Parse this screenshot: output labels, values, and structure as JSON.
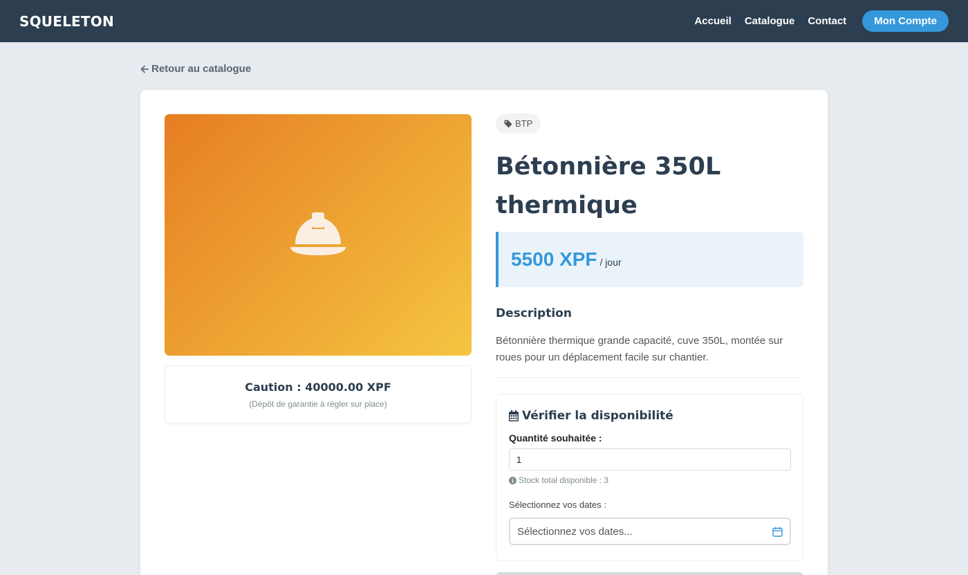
{
  "navbar": {
    "brand": "SQUELETON",
    "links": [
      "Accueil",
      "Catalogue",
      "Contact"
    ],
    "account_button": "Mon Compte"
  },
  "back_link": "Retour au catalogue",
  "product": {
    "category": "BTP",
    "title_line1": "Bétonnière 350L",
    "title_line2": "thermique",
    "price": "5500 XPF",
    "price_unit": "/ jour",
    "description_heading": "Description",
    "description": "Bétonnière thermique grande capacité, cuve 350L, montée sur roues pour un déplacement facile sur chantier.",
    "deposit": "Caution : 40000.00 XPF",
    "deposit_note": "(Dépôt de garantie à régler sur place)",
    "image_icon": "hard-hat-icon",
    "accent_color": "#3498db"
  },
  "availability": {
    "heading": "Vérifier la disponibilité",
    "quantity_label": "Quantité souhaitée :",
    "quantity_value": "1",
    "stock_note": "Stock total disponible : 3",
    "dates_label": "Sélectionnez vos dates :",
    "dates_placeholder": "Sélectionnez vos dates..."
  }
}
